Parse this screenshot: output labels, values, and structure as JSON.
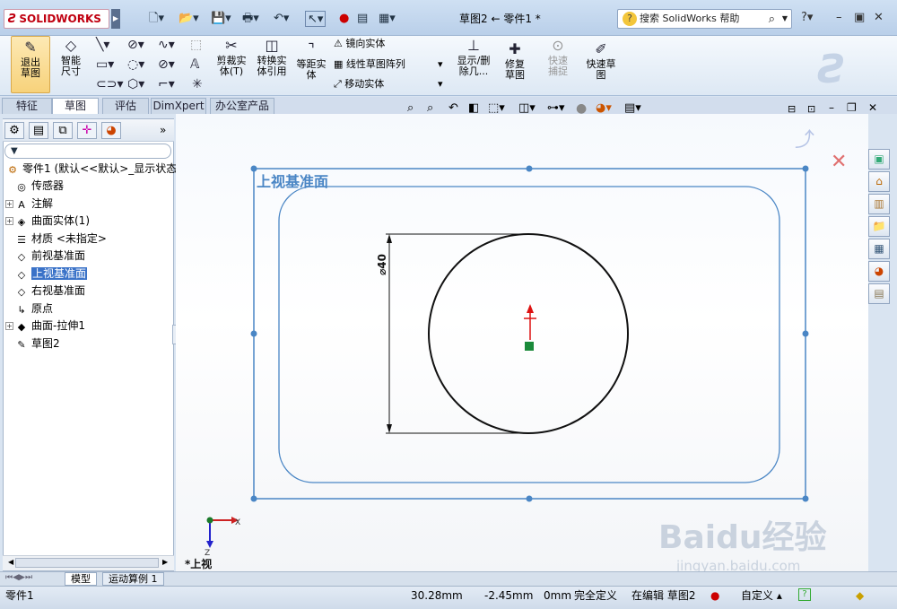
{
  "app": {
    "brand": "SOLIDWORKS",
    "doc_title": "草图2 ← 零件1 *"
  },
  "search": {
    "placeholder": "搜索 SolidWorks 帮助"
  },
  "ribbon": {
    "exit_sketch": "退出草图",
    "smart_dim": "智能尺寸",
    "trim": "剪裁实体(T)",
    "convert": "转换实体引用",
    "offset": "等距实体",
    "mirror": "镜向实体",
    "linear_pattern": "线性草图阵列",
    "move": "移动实体",
    "display_delete": "显示/删除几...",
    "repair": "修复草图",
    "quick_snap": "快速捕捉",
    "rapid_sketch": "快速草图"
  },
  "tabs": [
    "特征",
    "草图",
    "评估",
    "DimXpert",
    "办公室产品"
  ],
  "active_tab": "草图",
  "tree": {
    "root": "零件1 (默认<<默认>_显示状态",
    "items": [
      {
        "label": "传感器",
        "expander": "",
        "icon": "sensor-icon",
        "glyph": "◎"
      },
      {
        "label": "注解",
        "expander": "+",
        "icon": "annotation-icon",
        "glyph": "A"
      },
      {
        "label": "曲面实体(1)",
        "expander": "+",
        "icon": "surface-bodies-icon",
        "glyph": "◈"
      },
      {
        "label": "材质 <未指定>",
        "expander": "",
        "icon": "material-icon",
        "glyph": "☰"
      },
      {
        "label": "前视基准面",
        "expander": "",
        "icon": "plane-icon",
        "glyph": "◇"
      },
      {
        "label": "上视基准面",
        "expander": "",
        "icon": "plane-icon",
        "glyph": "◇",
        "selected": true
      },
      {
        "label": "右视基准面",
        "expander": "",
        "icon": "plane-icon",
        "glyph": "◇"
      },
      {
        "label": "原点",
        "expander": "",
        "icon": "origin-icon",
        "glyph": "↳"
      },
      {
        "label": "曲面-拉伸1",
        "expander": "+",
        "icon": "surface-extrude-icon",
        "glyph": "◆"
      },
      {
        "label": "草图2",
        "expander": "",
        "icon": "sketch-icon",
        "glyph": "✎"
      }
    ]
  },
  "viewport": {
    "plane_label": "上视基准面",
    "dimension_label": "⌀40",
    "view_name": "*上视",
    "triad_x": "X",
    "triad_z": "Z"
  },
  "bottom_tabs": [
    "模型",
    "运动算例 1"
  ],
  "status": {
    "part": "零件1",
    "x": "30.28mm",
    "y": "-2.45mm",
    "z": "0mm",
    "defined": "完全定义",
    "editing": "在编辑 草图2",
    "custom": "自定义"
  },
  "watermark": {
    "text": "Baidu经验",
    "url": "jingyan.baidu.com"
  },
  "colors": {
    "accent": "#3a72c8",
    "sketch_blue": "#4a86c5",
    "brand_red": "#c00010"
  }
}
